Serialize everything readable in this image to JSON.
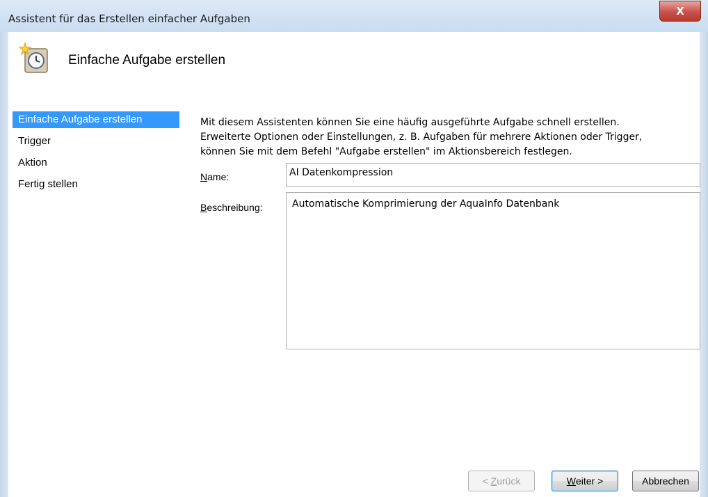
{
  "window": {
    "title": "Assistent für das Erstellen einfacher Aufgaben",
    "close_label": "X"
  },
  "header": {
    "title": "Einfache Aufgabe erstellen",
    "icon": "clock-task-icon"
  },
  "sidebar": {
    "items": [
      {
        "label": "Einfache Aufgabe erstellen",
        "active": true
      },
      {
        "label": "Trigger",
        "active": false
      },
      {
        "label": "Aktion",
        "active": false
      },
      {
        "label": "Fertig stellen",
        "active": false
      }
    ]
  },
  "main": {
    "intro_line1": "Mit diesem Assistenten können Sie eine häufig ausgeführte Aufgabe schnell erstellen.",
    "intro_line2": "Erweiterte Optionen oder Einstellungen, z. B. Aufgaben für mehrere Aktionen oder Trigger,",
    "intro_line3": "können Sie mit dem Befehl \"Aufgabe erstellen\" im Aktionsbereich festlegen.",
    "name_label_first": "N",
    "name_label_rest": "ame:",
    "name_value": "AI Datenkompression",
    "description_label_first": "B",
    "description_label_rest": "eschreibung:",
    "description_value": "Automatische Komprimierung der AquaInfo Datenbank"
  },
  "buttons": {
    "back_prefix": "< ",
    "back_accel": "Z",
    "back_rest": "urück",
    "next_accel": "W",
    "next_rest": "eiter >",
    "cancel": "Abbrechen"
  }
}
